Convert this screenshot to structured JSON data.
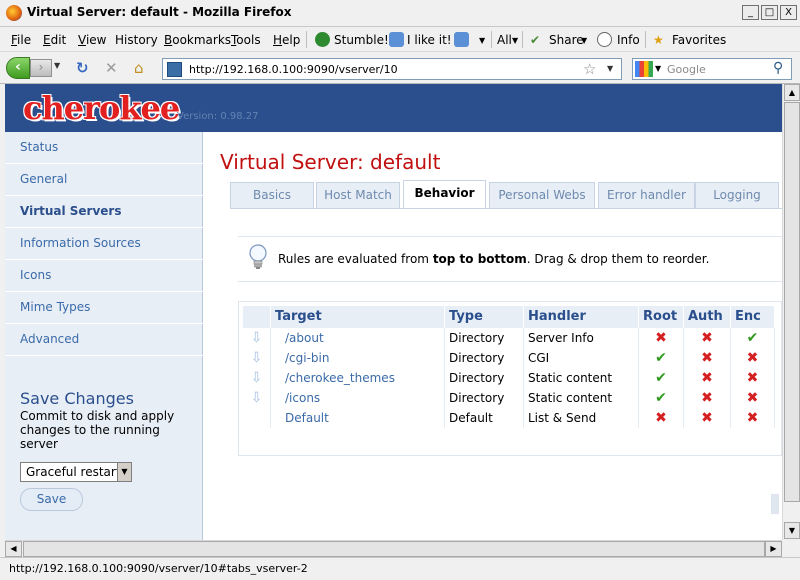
{
  "window": {
    "title": "Virtual Server: default - Mozilla Firefox",
    "minimize": "_",
    "maximize": "□",
    "close": "X"
  },
  "menu": {
    "items": [
      {
        "label": "File",
        "underline": "F",
        "rest": "ile"
      },
      {
        "label": "Edit",
        "underline": "E",
        "rest": "dit"
      },
      {
        "label": "View",
        "underline": "V",
        "rest": "iew"
      },
      {
        "label": "History",
        "underline": "",
        "rest": "History"
      },
      {
        "label": "Bookmarks",
        "underline": "B",
        "rest": "ookmarks"
      },
      {
        "label": "Tools",
        "underline": "T",
        "rest": "ools"
      },
      {
        "label": "Help",
        "underline": "H",
        "rest": "elp"
      }
    ],
    "stumble_label": "Stumble!",
    "likeit_label": "I like it!",
    "all_label": "All",
    "share_label": "Share",
    "info_label": "Info",
    "favorites_label": "Favorites"
  },
  "nav": {
    "url": "http://192.168.0.100:9090/vserver/10",
    "search_placeholder": "Google"
  },
  "app": {
    "logo": "cherokee",
    "version": "Version: 0.98.27"
  },
  "sidebar": {
    "items": [
      {
        "label": "Status"
      },
      {
        "label": "General"
      },
      {
        "label": "Virtual Servers"
      },
      {
        "label": "Information Sources"
      },
      {
        "label": "Icons"
      },
      {
        "label": "Mime Types"
      },
      {
        "label": "Advanced"
      }
    ],
    "save_title": "Save Changes",
    "save_desc": "Commit to disk and apply changes to the running server",
    "restart_selected": "Graceful restart",
    "save_button": "Save"
  },
  "main": {
    "page_title": "Virtual Server: default",
    "tabs": [
      {
        "label": "Basics"
      },
      {
        "label": "Host Match"
      },
      {
        "label": "Behavior"
      },
      {
        "label": "Personal Webs"
      },
      {
        "label": "Error handler"
      },
      {
        "label": "Logging"
      }
    ],
    "info_prefix": "Rules are evaluated from ",
    "info_bold": "top to bottom",
    "info_suffix": ". Drag & drop them to reorder."
  },
  "rules": {
    "headers": [
      "Target",
      "Type",
      "Handler",
      "Root",
      "Auth",
      "Enc"
    ],
    "rows": [
      {
        "target": "/about",
        "type": "Directory",
        "handler": "Server Info",
        "root": false,
        "auth": false,
        "enc": true,
        "draggable": true
      },
      {
        "target": "/cgi-bin",
        "type": "Directory",
        "handler": "CGI",
        "root": true,
        "auth": false,
        "enc": false,
        "draggable": true
      },
      {
        "target": "/cherokee_themes",
        "type": "Directory",
        "handler": "Static content",
        "root": true,
        "auth": false,
        "enc": false,
        "draggable": true
      },
      {
        "target": "/icons",
        "type": "Directory",
        "handler": "Static content",
        "root": true,
        "auth": false,
        "enc": false,
        "draggable": true
      },
      {
        "target": "Default",
        "type": "Default",
        "handler": "List & Send",
        "root": false,
        "auth": false,
        "enc": false,
        "draggable": false
      }
    ]
  },
  "status": {
    "text": "http://192.168.0.100:9090/vserver/10#tabs_vserver-2"
  },
  "colors": {
    "header_band": "#2a4f8c",
    "logo": "#e22020",
    "page_title": "#c01010",
    "link": "#3a6aa8",
    "check": "#2f9a1e",
    "cross": "#d42020"
  }
}
